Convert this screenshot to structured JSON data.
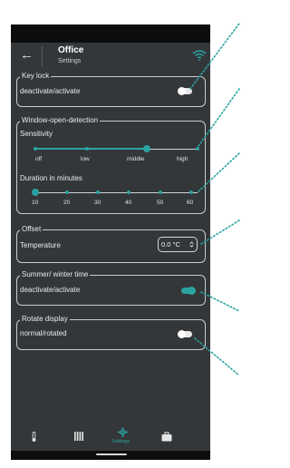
{
  "header": {
    "back_icon": "back-arrow-icon",
    "title": "Office",
    "subtitle": "Settings",
    "wifi_icon": "wifi-icon",
    "accent_color": "#2ba3a0"
  },
  "key_lock": {
    "legend": "Key lock",
    "label": "deactivate/activate",
    "state": "off"
  },
  "window_open_detection": {
    "legend": "Window-open-detection",
    "sensitivity_label": "Sensitivity",
    "sensitivity_options": [
      "off",
      "low",
      "middle",
      "high"
    ],
    "sensitivity_value": "middle",
    "duration_label": "Duration in minutes",
    "duration_options": [
      "10",
      "20",
      "30",
      "40",
      "50",
      "60"
    ],
    "duration_value": "10"
  },
  "offset": {
    "legend": "Offset",
    "label": "Temperature",
    "value": "0.0 °C"
  },
  "summer_winter": {
    "legend": "Summer/ winter time",
    "label": "deactivate/activate",
    "state": "on"
  },
  "rotate_display": {
    "legend": "Rotate display",
    "label": "normal/rotated",
    "state": "off"
  },
  "nav": {
    "items": [
      {
        "icon": "thermometer-icon",
        "label": ""
      },
      {
        "icon": "radiator-icon",
        "label": ""
      },
      {
        "icon": "settings-gear-icon",
        "label": "Settings",
        "active": true
      },
      {
        "icon": "briefcase-icon",
        "label": ""
      }
    ]
  }
}
